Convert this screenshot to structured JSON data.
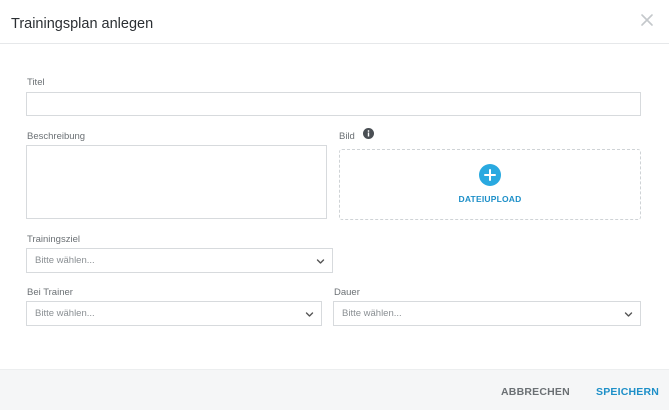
{
  "modal": {
    "title": "Trainingsplan anlegen"
  },
  "form": {
    "title_label": "Titel",
    "title_value": "",
    "description_label": "Beschreibung",
    "image_label": "Bild",
    "upload_label": "DATEIUPLOAD",
    "goal_label": "Trainingsziel",
    "goal_value": "Bitte wählen...",
    "trainer_label": "Bei Trainer",
    "trainer_value": "Bitte wählen...",
    "duration_label": "Dauer",
    "duration_value": "Bitte wählen..."
  },
  "footer": {
    "cancel_label": "ABBRECHEN",
    "save_label": "SPEICHERN"
  },
  "colors": {
    "accent": "#29a9e0",
    "accent_text": "#1d8fc8",
    "footer_bg": "#f5f6f7",
    "border": "#d7dadd"
  },
  "icons": {
    "close": "close-icon",
    "info": "info-icon",
    "upload": "plus-circle-icon",
    "dropdown": "chevron-down-icon"
  }
}
